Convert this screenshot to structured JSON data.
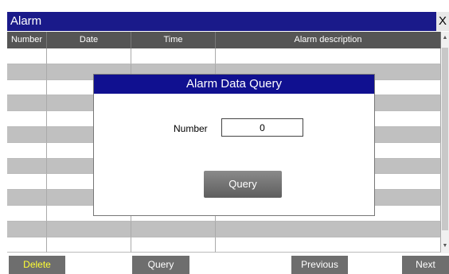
{
  "window": {
    "title": "Alarm",
    "close_label": "X"
  },
  "table": {
    "columns": [
      "Number",
      "Date",
      "Time",
      "Alarm description"
    ],
    "row_count": 13
  },
  "dialog": {
    "title": "Alarm Data Query",
    "field_label": "Number",
    "field_value": "0",
    "button_label": "Query"
  },
  "footer": {
    "delete_label": "Delete",
    "query_label": "Query",
    "previous_label": "Previous",
    "next_label": "Next"
  },
  "colors": {
    "titlebar": "#1a1a8a",
    "dialog_title": "#101090",
    "delete_text": "#ffff33",
    "header": "#555555"
  },
  "scrollbar": {
    "up_icon": "chevron-up-icon",
    "down_icon": "chevron-down-icon"
  }
}
